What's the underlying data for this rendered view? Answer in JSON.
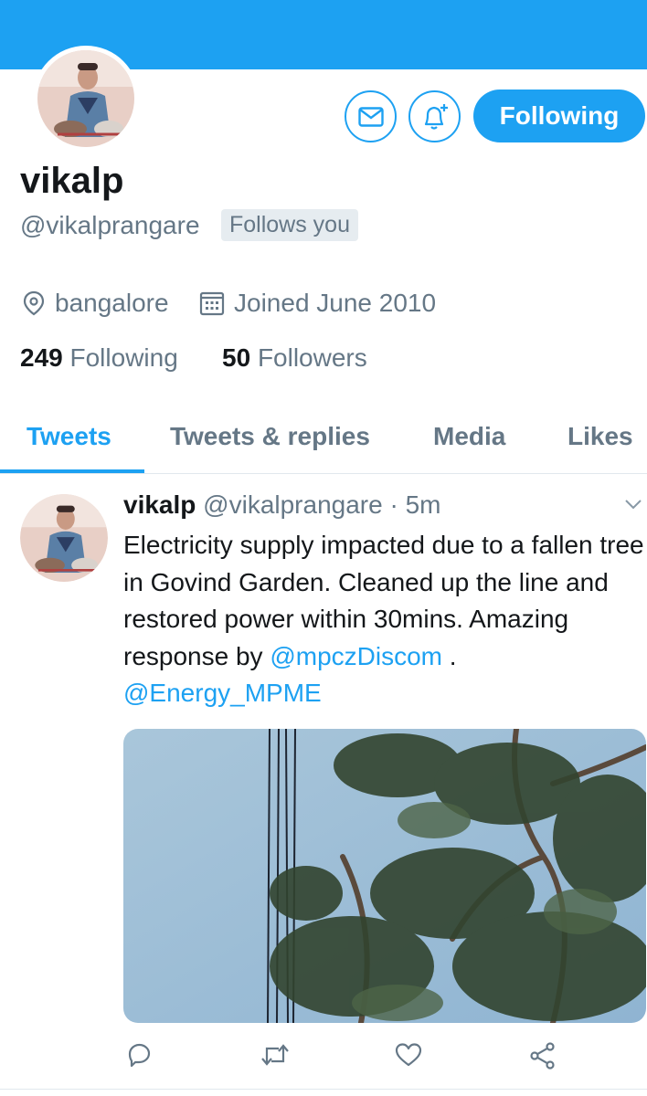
{
  "profile": {
    "name": "vikalp",
    "handle": "@vikalprangare",
    "follows_you": "Follows you",
    "location": "bangalore",
    "joined": "Joined June 2010",
    "following_count": "249",
    "following_label": "Following",
    "followers_count": "50",
    "followers_label": "Followers",
    "follow_button_label": "Following"
  },
  "icons": {
    "message": "envelope-icon",
    "notify": "bell-plus-icon",
    "location": "map-pin-icon",
    "calendar": "calendar-icon",
    "reply": "reply-icon",
    "retweet": "retweet-icon",
    "like": "heart-icon",
    "share": "share-icon",
    "more": "chevron-down-icon"
  },
  "tabs": [
    {
      "label": "Tweets"
    },
    {
      "label": "Tweets & replies"
    },
    {
      "label": "Media"
    },
    {
      "label": "Likes"
    }
  ],
  "tweet": {
    "name": "vikalp",
    "handle": "@vikalprangare",
    "dot": "·",
    "time": "5m",
    "text_1": "Electricity supply impacted due to a fallen tree in Govind Garden. Cleaned up the line and restored power within 30mins. Amazing response by ",
    "mention_1": "@mpczDiscom",
    "text_2": " . ",
    "mention_2": "@Energy_MPME"
  },
  "colors": {
    "accent": "#1da1f2",
    "text_primary": "#14171a",
    "text_secondary": "#657786",
    "badge_bg": "#e6ecf0"
  }
}
